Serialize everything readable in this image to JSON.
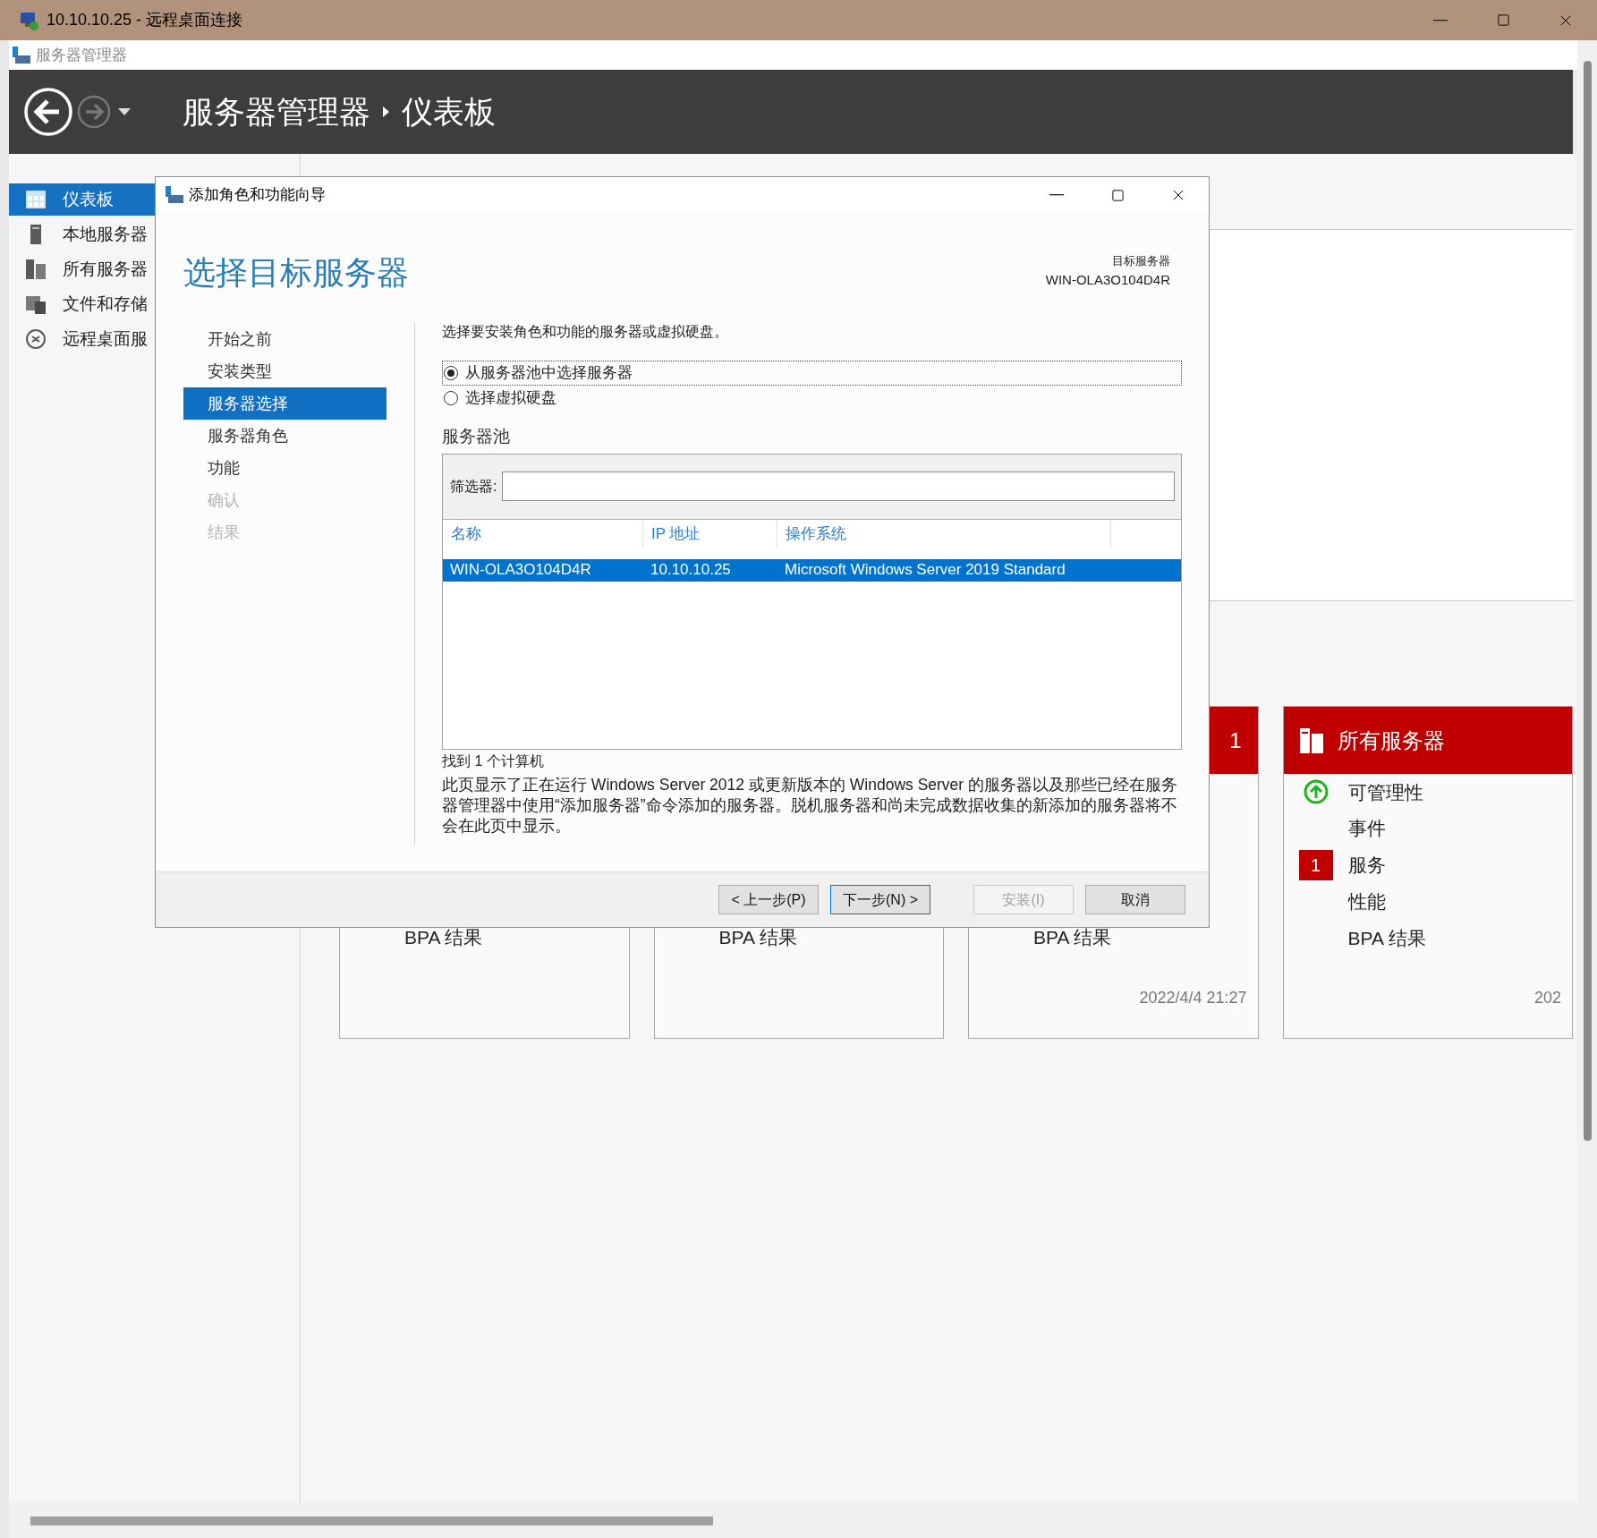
{
  "rdp_window": {
    "title": "10.10.10.25 - 远程桌面连接"
  },
  "app": {
    "title": "服务器管理器",
    "breadcrumb": [
      "服务器管理器",
      "仪表板"
    ]
  },
  "sidebar": {
    "items": [
      {
        "label": "仪表板",
        "selected": true
      },
      {
        "label": "本地服务器",
        "selected": false
      },
      {
        "label": "所有服务器",
        "selected": false
      },
      {
        "label": "文件和存储",
        "selected": false
      },
      {
        "label": "远程桌面服",
        "selected": false
      }
    ]
  },
  "tiles": [
    {
      "kind": "plain",
      "items": [
        {
          "label": "BPA 结果"
        }
      ]
    },
    {
      "kind": "plain",
      "items": [
        {
          "label": "BPA 结果"
        }
      ]
    },
    {
      "kind": "alert",
      "count": "1",
      "items": [
        {
          "label": "BPA 结果"
        }
      ],
      "timestamp": "2022/4/4 21:27"
    },
    {
      "kind": "alert",
      "title": "所有服务器",
      "items": [
        {
          "kind": "health",
          "label": "可管理性"
        },
        {
          "label": "事件"
        },
        {
          "kind": "badge",
          "label": "服务",
          "badge": "1"
        },
        {
          "label": "性能"
        },
        {
          "label": "BPA 结果"
        }
      ],
      "timestamp": "202"
    }
  ],
  "dialog": {
    "title": "添加角色和功能向导",
    "heading": "选择目标服务器",
    "target_label": "目标服务器",
    "target_value": "WIN-OLA3O104D4R",
    "steps": [
      {
        "label": "开始之前",
        "selected": false,
        "disabled": false
      },
      {
        "label": "安装类型",
        "selected": false,
        "disabled": false
      },
      {
        "label": "服务器选择",
        "selected": true,
        "disabled": false
      },
      {
        "label": "服务器角色",
        "selected": false,
        "disabled": false
      },
      {
        "label": "功能",
        "selected": false,
        "disabled": false
      },
      {
        "label": "确认",
        "selected": false,
        "disabled": true
      },
      {
        "label": "结果",
        "selected": false,
        "disabled": true
      }
    ],
    "description": "选择要安装角色和功能的服务器或虚拟硬盘。",
    "options": [
      {
        "label": "从服务器池中选择服务器",
        "selected": true
      },
      {
        "label": "选择虚拟硬盘",
        "selected": false
      }
    ],
    "pool": {
      "title": "服务器池",
      "filter_label": "筛选器:",
      "columns": [
        "名称",
        "IP 地址",
        "操作系统"
      ],
      "rows": [
        {
          "cells": [
            "WIN-OLA3O104D4R",
            "10.10.10.25",
            "Microsoft Windows Server 2019 Standard"
          ],
          "selected": true
        }
      ]
    },
    "count_text": "找到 1 个计算机",
    "note": "此页显示了正在运行 Windows Server 2012 或更新版本的 Windows Server 的服务器以及那些已经在服务器管理器中使用“添加服务器”命令添加的服务器。脱机服务器和尚未完成数据收集的新添加的服务器将不会在此页中显示。",
    "buttons": [
      {
        "label": "< 上一步(P)",
        "disabled": false,
        "default": false
      },
      {
        "label": "下一步(N) >",
        "disabled": false,
        "default": true
      },
      {
        "label": "安装(I)",
        "disabled": true,
        "default": false
      },
      {
        "label": "取消",
        "disabled": false,
        "default": false
      }
    ]
  }
}
